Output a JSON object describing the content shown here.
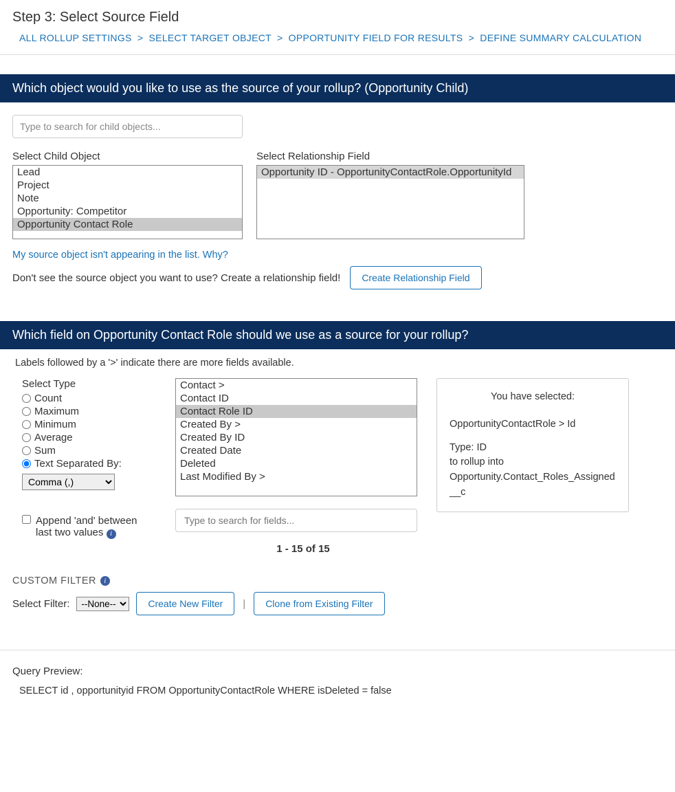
{
  "page_title": "Step 3: Select Source Field",
  "breadcrumb": {
    "items": [
      "ALL ROLLUP SETTINGS",
      "SELECT TARGET OBJECT",
      "OPPORTUNITY FIELD FOR RESULTS",
      "DEFINE SUMMARY CALCULATION"
    ],
    "sep": ">"
  },
  "source_object": {
    "header": "Which object would you like to use as the source of your rollup? (Opportunity Child)",
    "search_placeholder": "Type to search for child objects...",
    "child_label": "Select Child Object",
    "child_items": [
      "Lead",
      "Project",
      "Note",
      "Opportunity: Competitor",
      "Opportunity Contact Role"
    ],
    "child_selected": "Opportunity Contact Role",
    "rel_label": "Select Relationship Field",
    "rel_items": [
      "Opportunity ID - OpportunityContactRole.OpportunityId"
    ],
    "rel_selected": "Opportunity ID - OpportunityContactRole.OpportunityId",
    "help_link": "My source object isn't appearing in the list. Why?",
    "help_text": "Don't see the source object you want to use? Create a relationship field!",
    "create_rel_btn": "Create Relationship Field"
  },
  "source_field": {
    "header": "Which field on Opportunity Contact Role should we use as a source for your rollup?",
    "note": "Labels followed by a '>' indicate there are more fields available.",
    "type_label": "Select Type",
    "types": [
      "Count",
      "Maximum",
      "Minimum",
      "Average",
      "Sum",
      "Text Separated By:"
    ],
    "type_selected": "Text Separated By:",
    "delimiter_options": [
      "Comma (,)"
    ],
    "delimiter_selected": "Comma (,)",
    "append_label": "Append 'and' between last two values",
    "field_items": [
      "Contact >",
      "Contact ID",
      "Contact Role ID",
      "Created By >",
      "Created By ID",
      "Created Date",
      "Deleted",
      "Last Modified By >"
    ],
    "field_selected": "Contact Role ID",
    "field_search_placeholder": "Type to search for fields...",
    "pagination": "1 - 15 of 15",
    "summary": {
      "label": "You have selected:",
      "path": "OpportunityContactRole > Id",
      "type_line": "Type: ID",
      "rollup_line": "to rollup into",
      "target": "Opportunity.Contact_Roles_Assigned__c"
    }
  },
  "filter": {
    "title": "CUSTOM FILTER",
    "select_label": "Select Filter:",
    "select_value": "--None--",
    "create_btn": "Create New Filter",
    "clone_btn": "Clone from Existing Filter"
  },
  "query": {
    "label": "Query Preview:",
    "text": "SELECT id , opportunityid FROM OpportunityContactRole WHERE isDeleted = false"
  }
}
